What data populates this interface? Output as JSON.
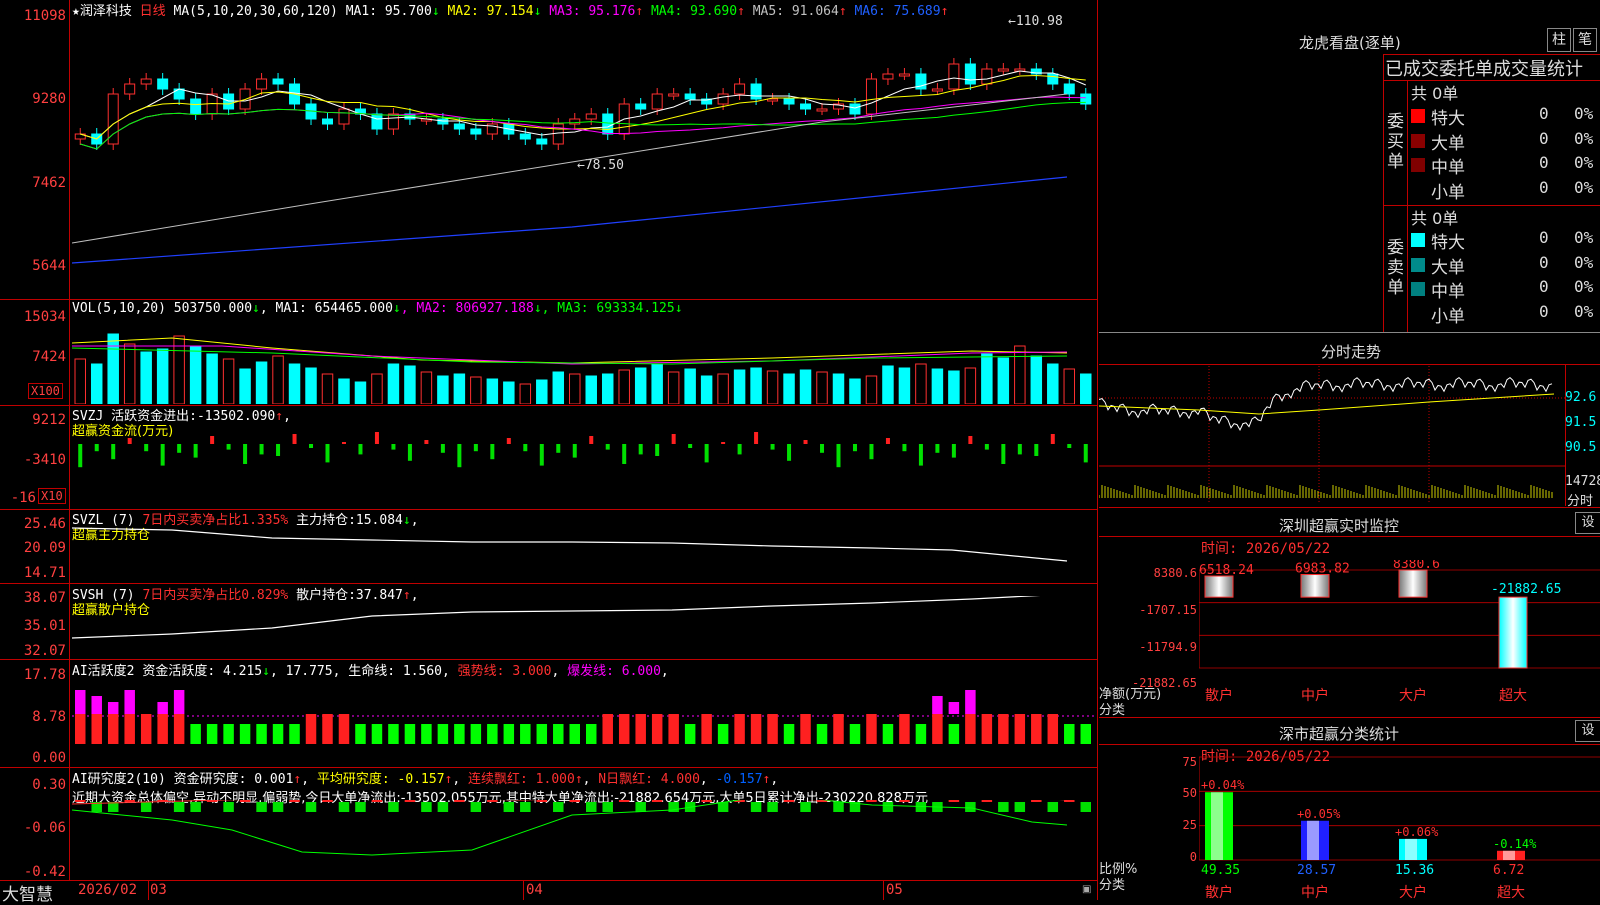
{
  "stock": {
    "star": "★",
    "name": "润泽科技",
    "period": "日线"
  },
  "kline": {
    "ma_label": "MA(5,10,20,30,60,120)",
    "ma": [
      {
        "label": "MA1:",
        "value": "95.700",
        "arrow": "↓",
        "color": "#ffffff"
      },
      {
        "label": "MA2:",
        "value": "97.154",
        "arrow": "↓",
        "color": "#ffff00"
      },
      {
        "label": "MA3:",
        "value": "95.176",
        "arrow": "↑",
        "color": "#ff00ff"
      },
      {
        "label": "MA4:",
        "value": "93.690",
        "arrow": "↑",
        "color": "#00ff00"
      },
      {
        "label": "MA5:",
        "value": "91.064",
        "arrow": "↑",
        "color": "#c0c0c0"
      },
      {
        "label": "MA6:",
        "value": "75.689",
        "arrow": "↑",
        "color": "#0000ff"
      }
    ],
    "yticks": [
      "11098",
      "9280",
      "7462",
      "5644"
    ],
    "high_label": "110.98",
    "low_label": "78.50",
    "close_values": [
      93,
      91,
      101,
      103,
      104,
      102,
      100,
      97,
      101,
      98,
      102,
      104,
      103,
      99,
      96,
      95,
      98,
      97,
      94,
      97,
      96,
      96,
      95,
      94,
      93,
      95,
      93,
      92,
      91,
      95,
      96,
      97,
      93,
      99,
      98,
      101,
      101,
      100,
      99,
      101,
      103,
      100,
      100,
      99,
      98,
      98,
      99,
      97,
      104,
      105,
      105,
      102,
      102,
      107,
      103,
      106,
      106,
      106,
      105,
      103,
      101,
      99
    ]
  },
  "vol": {
    "title": "VOL(5,10,20)",
    "value": "503750.000",
    "ma": [
      {
        "label": "MA1:",
        "value": "654465.000",
        "arrow": "↓",
        "color": "#ffffff"
      },
      {
        "label": "MA2:",
        "value": "806927.188",
        "arrow": "↓",
        "color": "#ff00ff"
      },
      {
        "label": "MA3:",
        "value": "693334.125",
        "arrow": "↓",
        "color": "#00ff00"
      }
    ],
    "yticks": [
      "15034",
      "7424"
    ],
    "unit": "X100"
  },
  "svzj": {
    "title": "SVZJ",
    "label": "活跃资金进出:",
    "value": "-13502.090",
    "arrow": "↑",
    "subtitle": "超赢资金流(万元)",
    "yticks": [
      "9212",
      "-3410",
      "-16"
    ],
    "unit": "X10"
  },
  "svzl": {
    "title": "SVZL",
    "param": "(7)",
    "desc": "7日内买卖净占比1.335%",
    "label": "主力持仓:",
    "value": "15.084",
    "arrow": "↓",
    "subtitle": "超赢主力持仓",
    "yticks": [
      "25.46",
      "20.09",
      "14.71"
    ]
  },
  "svsh": {
    "title": "SVSH",
    "param": "(7)",
    "desc": "7日内买卖净占比0.829%",
    "label": "散户持仓:",
    "value": "37.847",
    "arrow": "↑",
    "subtitle": "超赢散户持仓",
    "yticks": [
      "38.07",
      "35.01",
      "32.07"
    ]
  },
  "ai_active": {
    "title": "AI活跃度2",
    "label": "资金活跃度:",
    "value": "4.215",
    "arrow": "↓",
    "v2": "17.775",
    "life": "生命线: 1.560",
    "strong": "强势线: 3.000",
    "burst": "爆发线: 6.000",
    "yticks": [
      "17.78",
      "8.78",
      "0.00"
    ]
  },
  "ai_research": {
    "title": "AI研究度2(10)",
    "label": "资金研究度:",
    "value": "0.001",
    "arrow": "↑",
    "avg": "平均研究度: -0.157",
    "streak": "连续飘红: 1.000",
    "nred": "N日飘红: 4.000",
    "last": "-0.157",
    "summary": "近期大资金总体偏空,异动不明显,偏弱势,今日大单净流出:-13502.055万元,其中特大单净流出:-21882.654万元,大单5日累计净出-230220.828万元",
    "yticks": [
      "0.30",
      "-0.06",
      "-0.42"
    ]
  },
  "xaxis": {
    "labels": [
      "2026/02",
      "03",
      "04",
      "05"
    ]
  },
  "logo": "大智慧",
  "dragon": {
    "title": "龙虎看盘(逐单)",
    "btn_zhu": "柱",
    "btn_bi": "笔",
    "header": "已成交委托单成交量统计",
    "buy_label": "委买单",
    "sell_label": "委卖单",
    "buy_total": "共 0单",
    "sell_total": "共 0单",
    "buy_rows": [
      {
        "name": "特大",
        "count": "0",
        "pct": "0%",
        "color": "#ff0000"
      },
      {
        "name": "大单",
        "count": "0",
        "pct": "0%",
        "color": "#8b0000"
      },
      {
        "name": "中单",
        "count": "0",
        "pct": "0%",
        "color": "#800000"
      },
      {
        "name": "小单",
        "count": "0",
        "pct": "0%",
        "color": ""
      }
    ],
    "sell_rows": [
      {
        "name": "特大",
        "count": "0",
        "pct": "0%",
        "color": "#00ffff"
      },
      {
        "name": "大单",
        "count": "0",
        "pct": "0%",
        "color": "#008b8b"
      },
      {
        "name": "中单",
        "count": "0",
        "pct": "0%",
        "color": "#008080"
      },
      {
        "name": "小单",
        "count": "0",
        "pct": "0%",
        "color": ""
      }
    ]
  },
  "intraday": {
    "title": "分时走势",
    "yticks": [
      "92.6",
      "91.5",
      "90.5"
    ],
    "vol_label": "14728",
    "vol_unit": "分时"
  },
  "monitor": {
    "title": "深圳超赢实时监控",
    "setting": "设",
    "time": "时间: 2026/05/22",
    "yticks": [
      "8380.6",
      "-1707.15",
      "-11794.9",
      "-21882.65"
    ],
    "ylabel1": "净额(万元)",
    "ylabel2": "分类",
    "categories": [
      "散户",
      "中户",
      "大户",
      "超大"
    ],
    "values": [
      "6518.24",
      "6983.82",
      "8380.6",
      "-21882.65"
    ]
  },
  "classify": {
    "title": "深市超赢分类统计",
    "setting": "设",
    "time": "时间: 2026/05/22",
    "yticks": [
      "75",
      "50",
      "25",
      "0"
    ],
    "ylabel1": "比例%",
    "ylabel2": "分类",
    "categories": [
      "散户",
      "中户",
      "大户",
      "超大"
    ],
    "changes": [
      "+0.04%",
      "+0.05%",
      "+0.06%",
      "-0.14%"
    ],
    "values": [
      "49.35",
      "28.57",
      "15.36",
      "6.72"
    ]
  },
  "chart_data": [
    {
      "type": "bar",
      "title": "深圳超赢实时监控",
      "ylabel": "净额(万元)",
      "categories": [
        "散户",
        "中户",
        "大户",
        "超大"
      ],
      "values": [
        6518.24,
        6983.82,
        8380.6,
        -21882.65
      ],
      "ylim": [
        -21882.65,
        8380.6
      ]
    },
    {
      "type": "bar",
      "title": "深市超赢分类统计",
      "ylabel": "比例%",
      "categories": [
        "散户",
        "中户",
        "大户",
        "超大"
      ],
      "values": [
        49.35,
        28.57,
        15.36,
        6.72
      ],
      "ylim": [
        0,
        75
      ]
    }
  ]
}
